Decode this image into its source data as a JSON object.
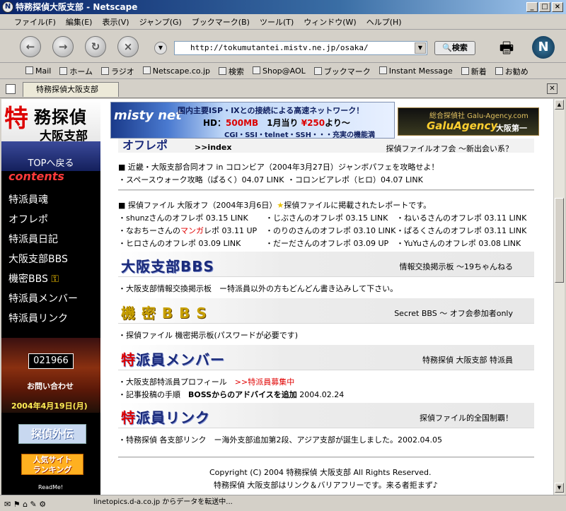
{
  "window": {
    "title": "特務探偵大阪支部 - Netscape"
  },
  "menu": [
    "ファイル(F)",
    "編集(E)",
    "表示(V)",
    "ジャンプ(G)",
    "ブックマーク(B)",
    "ツール(T)",
    "ウィンドウ(W)",
    "ヘルプ(H)"
  ],
  "nav": {
    "url": "http://tokumutantei.mistv.ne.jp/osaka/",
    "search_label": "検索"
  },
  "bookmarks": [
    "Mail",
    "ホーム",
    "ラジオ",
    "Netscape.co.jp",
    "検索",
    "Shop@AOL",
    "ブックマーク",
    "Instant Message",
    "新着",
    "お勧め"
  ],
  "tab": {
    "label": "特務探偵大阪支部"
  },
  "status": {
    "text": "linetopics.d-a.co.jp からデータを転送中..."
  },
  "sidebar": {
    "logo": {
      "a": "特",
      "b": "務探偵",
      "c": "大阪支部"
    },
    "top_back": "TOPへ戻る",
    "contents_heading": "contents",
    "items": [
      "特派員魂",
      "オフレポ",
      "特派員日記",
      "大阪支部BBS",
      "機密BBS",
      "特派員メンバー",
      "特派員リンク"
    ],
    "counter": "021966",
    "inquiry": "お問い合わせ",
    "date": "2004年4月19日(月)",
    "banner_tei": "探偵外伝",
    "banner_ninki": [
      "人気サイト",
      "ランキング"
    ],
    "readme": "ReadMe!"
  },
  "ads": {
    "misty": {
      "logo": "misty net",
      "line1": "国内主要ISP・IXとの接続による高速ネットワーク！",
      "line2a": "HD：",
      "line2b": "500MB",
      "line2c": "1月当り",
      "line2d": "¥250",
      "line2e": "より〜",
      "line3": "CGI・SSI・telnet・SSH・・・充実の機能満載！！"
    },
    "galu": {
      "top": "総合探偵社 Galu-Agency.com",
      "name": "GaluAgency",
      "suffix": "大阪第一"
    }
  },
  "offrepo": {
    "heading_partial": "オフレポ",
    "index": ">>index",
    "desc": "探偵ファイルオフ会 〜新出会い系？",
    "item1": "■ 近畿・大阪支部合同オフ in コロンビア（2004年3月27日）ジャンボパフェを攻略せよ！",
    "item1_links": [
      "・スペースウォーク攻略（ぱるく）04.07 LINK",
      "・コロンビアレポ（ヒロ）04.07 LINK"
    ],
    "item2a": "■ 探偵ファイル 大阪オフ（2004年3月6日）",
    "item2_star": "★",
    "item2b": "探偵ファイルに掲載されたレポートです。",
    "links": [
      "・shunzさんのオフレポ 03.15 LINK",
      "・じぶさんのオフレポ 03.15 LINK",
      "・ねいるさんのオフレポ 03.11 LINK",
      "",
      "・のりのさんのオフレポ 03.10 LINK",
      "・ぱるくさんのオフレポ 03.11 LINK",
      "・ヒロさんのオフレポ 03.09 LINK",
      "・だーださんのオフレポ 03.09 UP",
      "・YuYuさんのオフレポ 03.08 LINK"
    ],
    "nao_a": "・なおちーさんの",
    "nao_b": "マンガ",
    "nao_c": "レポ 03.11 UP"
  },
  "sections": [
    {
      "head_red": "",
      "head": "大阪支部BBS",
      "desc": "情報交換掲示板 〜19ちゃんねる",
      "lines": [
        "・大阪支部情報交換掲示板　ー特派員以外の方もどんどん書き込みして下さい。"
      ]
    },
    {
      "head_red": "",
      "head": "機 密 B B S",
      "desc": "Secret BBS 〜 オフ会参加者only",
      "lines": [
        "・探偵ファイル 機密掲示板(パスワードが必要です)"
      ]
    },
    {
      "head_red": "特",
      "head": "派員メンバー",
      "desc": "特務探偵 大阪支部 特派員"
    },
    {
      "head_red": "特",
      "head": "派員リンク",
      "desc": "探偵ファイル的全国制覇！",
      "lines": [
        "・特務探偵 各支部リンク　ー海外支部追加第2段、アジア支部が誕生しました。2002.04.05"
      ]
    }
  ],
  "member": {
    "l1a": "・大阪支部特派員プロフィール",
    "l1b": ">>特派員募集中",
    "l2a": "・記事投稿の手順",
    "l2b": "BOSSからのアドバイスを追加",
    "l2c": "2004.02.24"
  },
  "footer": {
    "copyright": "Copyright (C) 2004 特務探偵 大阪支部 All Rights Reserved.",
    "note": "特務探偵 大阪支部はリンク＆バリアフリーです。来る者拒まず♪"
  }
}
